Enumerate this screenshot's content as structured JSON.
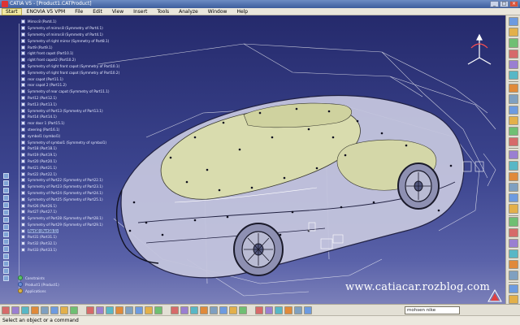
{
  "window": {
    "title": "CATIA V5 - [Product1.CATProduct]",
    "controls": {
      "minimize": "_",
      "restore": "□",
      "close": "×"
    }
  },
  "menu": {
    "items": [
      "Start",
      "ENOVIA V5 VPM",
      "File",
      "Edit",
      "View",
      "Insert",
      "Tools",
      "Analyze",
      "Window",
      "Help"
    ]
  },
  "tree": {
    "items": [
      "Mirror.8 (Part4.1)",
      "Symmetry of mirror.8 (Symmetry of Part4.1)",
      "Symmetry of mirror.8 (Symmetry of Part4.1)",
      "Symmetry of right mirror (Symmetry of Part8.1)",
      "Part9 (Part9.1)",
      "right front capot (Part10.1)",
      "right front capot2 (Part10.2)",
      "Symmetry of right front capot (Symmetry of Part10.1)",
      "Symmetry of right front capot (Symmetry of Part10.2)",
      "rear capot (Part11.1)",
      "rear capot 2 (Part11.2)",
      "Symmetry of rear capot (Symmetry of Part11.1)",
      "Part12 (Part12.1)",
      "Part13 (Part13.1)",
      "Symmetry of Part13 (Symmetry of Part13.1)",
      "Part14 (Part14.1)",
      "rear door 1 (Part15.1)",
      "steering (Part16.1)",
      "symbol1 (symbol1)",
      "Symmetry of symbol1 (Symmetry of symbol1)",
      "Part18 (Part18.1)",
      "Part19 (Part19.1)",
      "Part20 (Part20.1)",
      "Part21 (Part21.1)",
      "Part22 (Part22.1)",
      "Symmetry of Part22 (Symmetry of Part22.1)",
      "Symmetry of Part23 (Symmetry of Part23.1)",
      "Symmetry of Part24 (Symmetry of Part24.1)",
      "Symmetry of Part25 (Symmetry of Part25.1)",
      "Part26 (Part26.1)",
      "Part27 (Part27.1)",
      "Symmetry of Part28 (Symmetry of Part28.1)",
      "Symmetry of Part29 (Symmetry of Part29.1)",
      "Part30 (Part30.1)",
      "Part31 (Part31.1)",
      "Part32 (Part32.1)",
      "Part33 (Part33.1)"
    ],
    "selected_index": 33,
    "footer": [
      "Constraints",
      "Product1 (Product1)",
      "Applications"
    ]
  },
  "watermark": "www.catiacar.rozblog.com",
  "command_input": {
    "value": "mohsen nike"
  },
  "status": {
    "text": "Select an object or a command"
  },
  "colors": {
    "viewport_top": "#252a6c",
    "viewport_bottom": "#7b80b9",
    "car_surface": "#d9dcae",
    "wire": "#f2f2f2",
    "toolbar_bg": "#e3e0d5"
  },
  "icons": {
    "right_toolbar": [
      "sketch-icon",
      "extrude-icon",
      "revolve-icon",
      "sweep-icon",
      "fill-icon",
      "blend-icon",
      "join-icon",
      "split-icon",
      "trim-icon",
      "boundary-icon",
      "extract-icon",
      "fillet-icon",
      "translate-icon",
      "rotate-icon",
      "symmetry-icon",
      "scale-icon",
      "affinity-icon",
      "axis-icon",
      "plane-icon",
      "point-icon",
      "line-icon",
      "curve-icon",
      "spline-icon",
      "helix-icon",
      "analysis-icon",
      "law-icon"
    ],
    "bottom_toolbar": [
      "fit-all-icon",
      "pan-icon",
      "rotate-view-icon",
      "zoom-in-icon",
      "zoom-out-icon",
      "normal-view-icon",
      "iso-view-icon",
      "shading-icon",
      "hide-show-icon",
      "swap-icon",
      "measure-icon",
      "update-icon",
      "cut-icon",
      "copy-icon",
      "paste-icon",
      "undo-icon",
      "redo-icon",
      "help-icon",
      "catalog-icon",
      "sketcher-icon",
      "compass-icon",
      "grid-icon",
      "snap-icon",
      "orientation-icon",
      "material-icon",
      "render-icon",
      "apply-icon",
      "capture-icon",
      "print-icon",
      "save-icon"
    ]
  }
}
